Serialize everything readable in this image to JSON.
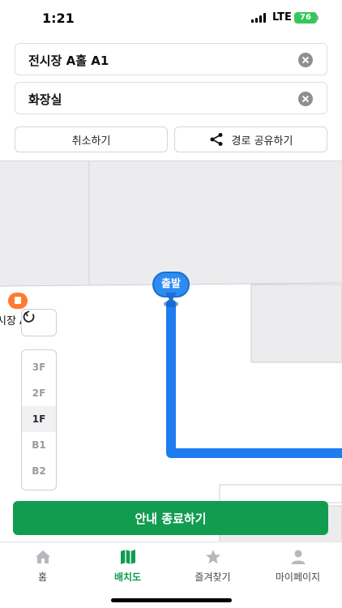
{
  "status_bar": {
    "time": "1:21",
    "network": "LTE",
    "battery": "76"
  },
  "route": {
    "origin": "전시장 A홀 A1",
    "destination": "화장실"
  },
  "actions": {
    "cancel_label": "취소하기",
    "share_label": "경로 공유하기"
  },
  "map": {
    "poi_label": "시장 A",
    "start_label": "출발",
    "floors": [
      "3F",
      "2F",
      "1F",
      "B1",
      "B2"
    ],
    "selected_floor": "1F",
    "route_color": "#1f7cf0"
  },
  "end_button_label": "안내 종료하기",
  "tabs": [
    {
      "label": "홈",
      "icon": "home-icon"
    },
    {
      "label": "배치도",
      "icon": "map-icon",
      "active": true
    },
    {
      "label": "즐겨찾기",
      "icon": "star-icon"
    },
    {
      "label": "마이페이지",
      "icon": "person-icon"
    }
  ],
  "accent_color": "#119c4f"
}
